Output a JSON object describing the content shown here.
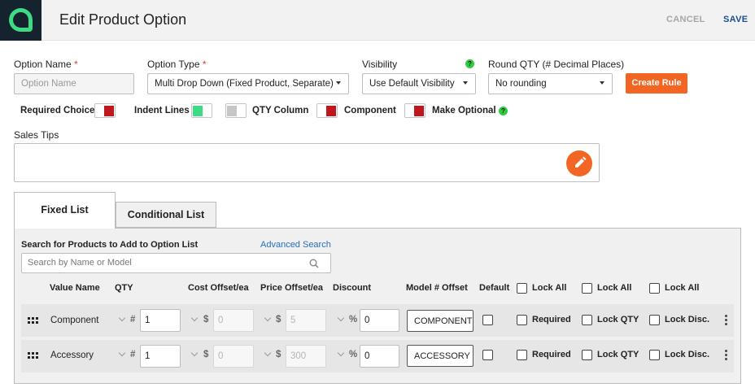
{
  "header": {
    "title": "Edit Product Option",
    "cancel_label": "CANCEL",
    "save_label": "SAVE"
  },
  "form": {
    "option_name_label": "Option Name",
    "option_name_placeholder": "Option Name",
    "option_type_label": "Option Type",
    "option_type_value": "Multi Drop Down (Fixed Product, Separate)",
    "visibility_label": "Visibility",
    "visibility_value": "Use Default Visibility",
    "round_qty_label": "Round QTY (# Decimal Places)",
    "round_qty_value": "No rounding",
    "create_rule_label": "Create Rule",
    "required_star": "*",
    "help_glyph": "?"
  },
  "toggles": {
    "required_choice": "Required Choice",
    "indent_lines": "Indent Lines",
    "qty_column": "QTY Column",
    "component": "Component",
    "make_optional": "Make Optional"
  },
  "sales_tips_label": "Sales Tips",
  "tabs": {
    "fixed": "Fixed List",
    "conditional": "Conditional List"
  },
  "list": {
    "search_label": "Search for Products to Add to Option List",
    "advanced_search": "Advanced Search",
    "search_placeholder": "Search by Name or Model",
    "columns": {
      "value_name": "Value Name",
      "qty": "QTY",
      "cost": "Cost Offset/ea",
      "price": "Price Offset/ea",
      "discount": "Discount",
      "model": "Model # Offset",
      "default": "Default",
      "lock_all": "Lock All"
    },
    "symbols": {
      "hash": "#",
      "dollar": "$",
      "percent": "%"
    },
    "row_labels": {
      "required": "Required",
      "lock_qty": "Lock QTY",
      "lock_disc": "Lock Disc."
    },
    "rows": [
      {
        "name": "Component",
        "qty": "1",
        "cost": "0",
        "price": "5",
        "discount": "0",
        "model": "COMPONENT"
      },
      {
        "name": "Accessory",
        "qty": "1",
        "cost": "0",
        "price": "300",
        "discount": "0",
        "model": "ACCESSORY"
      }
    ]
  },
  "colors": {
    "accent": "#f26522",
    "save": "#1a4d8f",
    "toggle_red": "#c0161e",
    "toggle_green": "#3ddc84",
    "logo_bg": "#14232e"
  },
  "icons": [
    "logo-icon",
    "help-icon",
    "pencil-icon",
    "search-icon",
    "drag-handle-icon",
    "chevron-down-icon",
    "more-vertical-icon"
  ]
}
